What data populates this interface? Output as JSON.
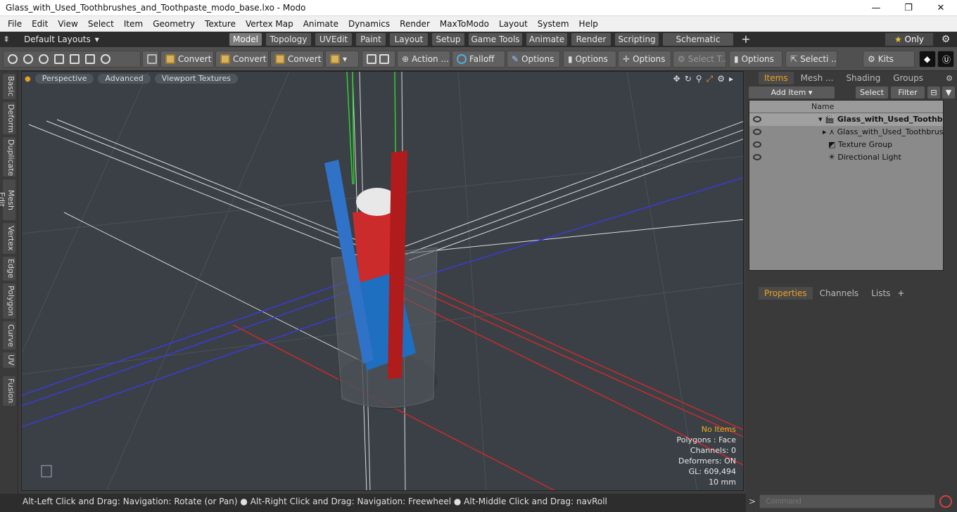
{
  "window": {
    "title": "Glass_with_Used_Toothbrushes_and_Toothpaste_modo_base.lxo - Modo",
    "minimize": "—",
    "maximize": "❐",
    "close": "✕"
  },
  "menu": [
    "File",
    "Edit",
    "View",
    "Select",
    "Item",
    "Geometry",
    "Texture",
    "Vertex Map",
    "Animate",
    "Dynamics",
    "Render",
    "MaxToModo",
    "Layout",
    "System",
    "Help"
  ],
  "layout": {
    "label": "Default Layouts"
  },
  "tabs": [
    "Model",
    "Topology",
    "UVEdit",
    "Paint",
    "Layout",
    "Setup",
    "Game Tools",
    "Animate",
    "Render",
    "Scripting",
    "Schematic Fusion"
  ],
  "only_label": "Only",
  "toolbar": {
    "convert1": "Convert",
    "convert2": "Convert",
    "convert3": "Convert",
    "action": "Action ...",
    "falloff": "Falloff",
    "options1": "Options",
    "options2": "Options",
    "options3": "Options",
    "select_t": "Select T...",
    "options4": "Options",
    "selecti": "Selecti ...",
    "kits": "Kits"
  },
  "left_tabs": [
    "Basic",
    "Deform",
    "Duplicate",
    "Mesh Edit",
    "Vertex",
    "Edge",
    "Polygon",
    "Curve",
    "UV",
    "Fusion"
  ],
  "viewport": {
    "perspective": "Perspective",
    "advanced": "Advanced",
    "textures": "Viewport Textures"
  },
  "info": {
    "no_items": "No Items",
    "polygons": "Polygons : Face",
    "channels": "Channels: 0",
    "deformers": "Deformers: ON",
    "gl": "GL: 609,494",
    "scale": "10 mm"
  },
  "status": {
    "hint1": "Alt-Left Click and Drag: Navigation: Rotate (or Pan)",
    "hint2": "Alt-Right Click and Drag: Navigation: Freewheel",
    "hint3": "Alt-Middle Click and Drag: navRoll"
  },
  "items_panel": {
    "tabs": [
      "Items",
      "Mesh ...",
      "Shading",
      "Groups"
    ],
    "add_item": "Add Item",
    "select": "Select",
    "filter": "Filter",
    "name_col": "Name",
    "rows": [
      {
        "name": "Glass_with_Used_Toothbr..."
      },
      {
        "name": "Glass_with_Used_Toothbrus ..."
      },
      {
        "name": "Texture Group"
      },
      {
        "name": "Directional Light"
      }
    ]
  },
  "props_panel": {
    "tabs": [
      "Properties",
      "Channels",
      "Lists"
    ]
  },
  "command": {
    "placeholder": "Command"
  }
}
